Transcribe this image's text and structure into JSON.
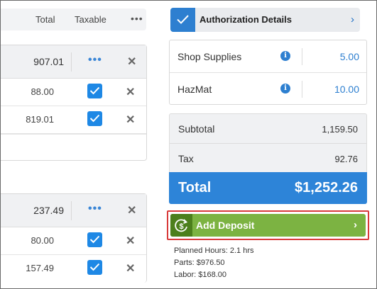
{
  "columns": {
    "total": "Total",
    "taxable": "Taxable",
    "more": "•••"
  },
  "groups": [
    {
      "total": "907.01",
      "more": "•••",
      "remove": "✕",
      "rows": [
        {
          "amount": "88.00",
          "taxable": true,
          "remove": "✕"
        },
        {
          "amount": "819.01",
          "taxable": true,
          "remove": "✕"
        }
      ]
    },
    {
      "total": "237.49",
      "more": "•••",
      "remove": "✕",
      "rows": [
        {
          "amount": "80.00",
          "taxable": true,
          "remove": "✕"
        },
        {
          "amount": "157.49",
          "taxable": true,
          "remove": "✕"
        }
      ]
    }
  ],
  "authorization": {
    "label": "Authorization Details",
    "checked": true,
    "chevron": "›"
  },
  "fees": [
    {
      "name": "Shop Supplies",
      "info": "i",
      "value": "5.00"
    },
    {
      "name": "HazMat",
      "info": "i",
      "value": "10.00"
    }
  ],
  "summary": {
    "subtotal_label": "Subtotal",
    "subtotal": "1,159.50",
    "tax_label": "Tax",
    "tax": "92.76",
    "total_label": "Total",
    "total": "$1,252.26"
  },
  "deposit": {
    "label": "Add Deposit",
    "chevron": "›",
    "icon": "dollar-refresh-icon"
  },
  "stats": {
    "planned_hours": "Planned Hours: 2.1 hrs",
    "parts": "Parts: $976.50",
    "labor": "Labor: $168.00"
  },
  "colors": {
    "accent_blue": "#2d84d8",
    "checkbox_blue": "#1e88e5",
    "deposit_green": "#7cb342",
    "deposit_dark_green": "#4c7f1c",
    "highlight_red": "#d83a3a"
  }
}
